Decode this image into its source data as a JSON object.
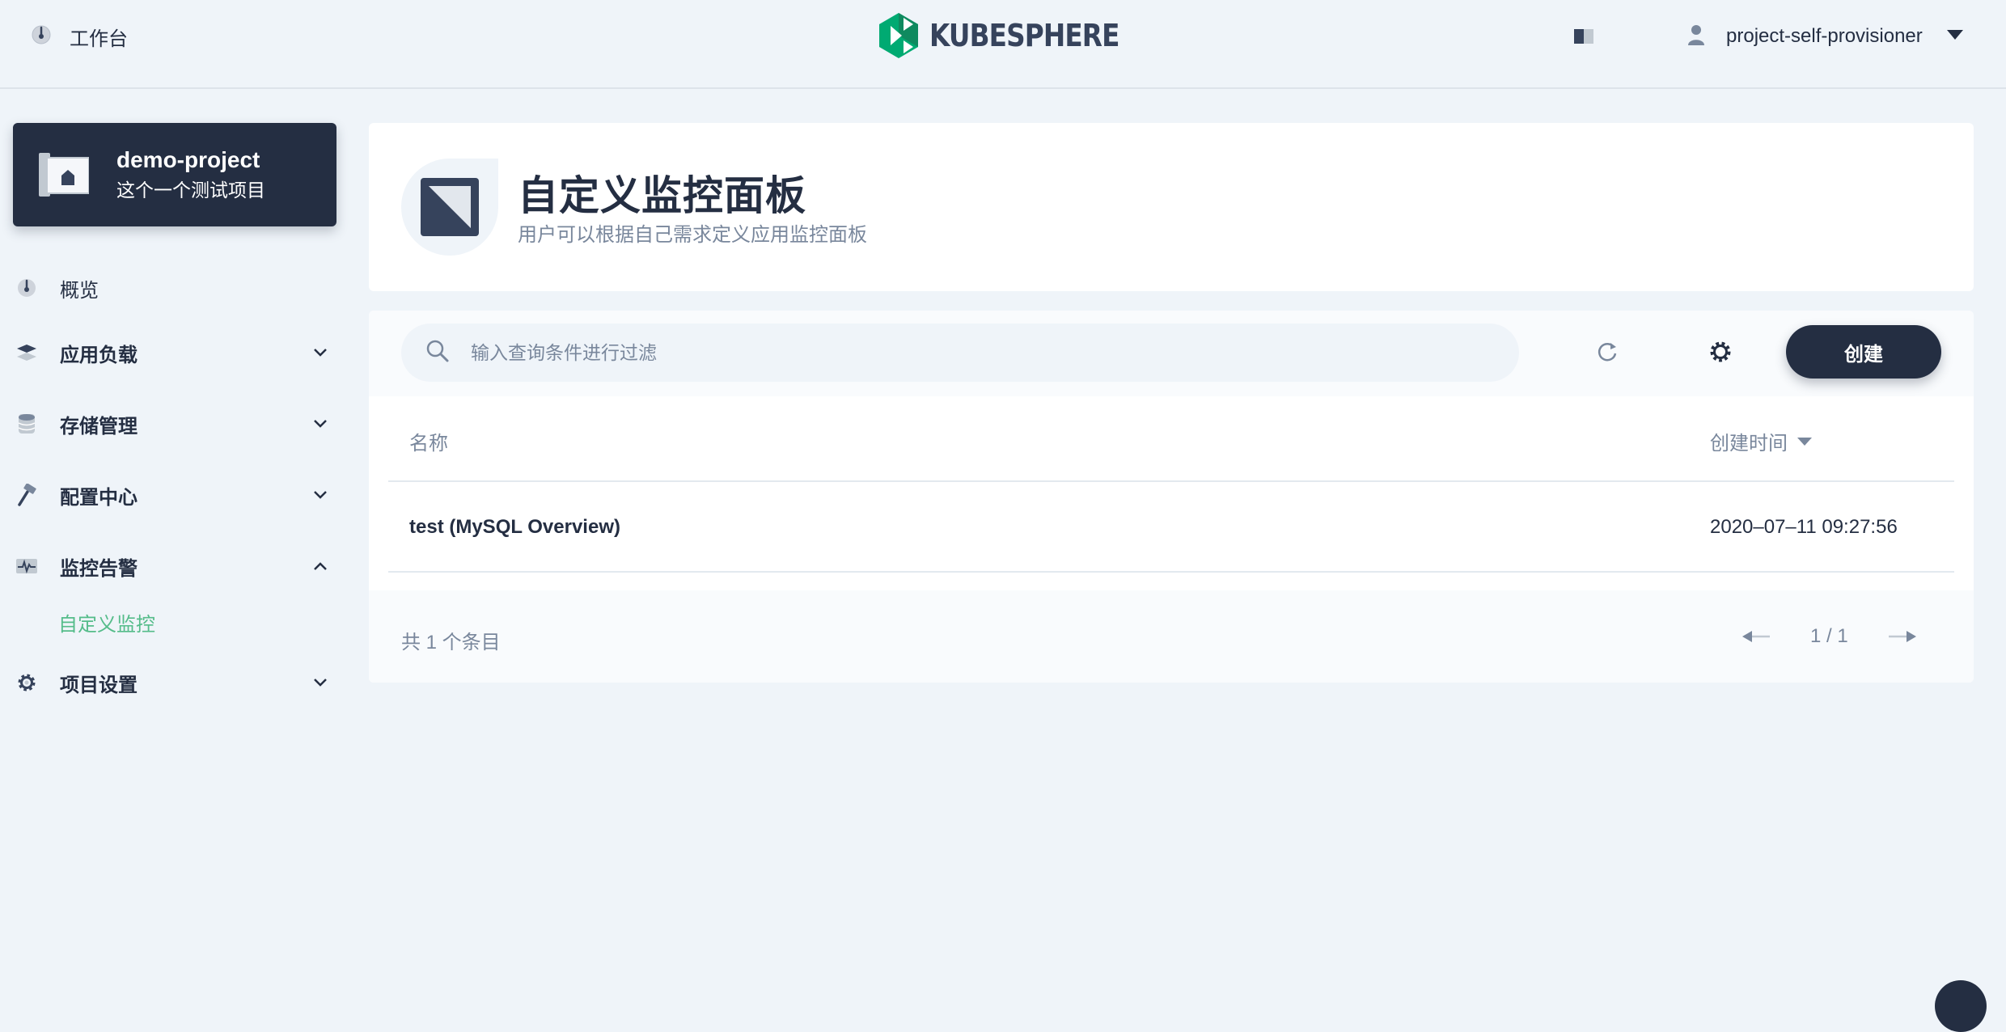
{
  "topbar": {
    "workbench_label": "工作台",
    "logo_text": "KUBESPHERE",
    "user_name": "project-self-provisioner"
  },
  "project": {
    "name": "demo-project",
    "description": "这个一个测试项目"
  },
  "sidebar": {
    "items": [
      {
        "label": "概览",
        "icon": "dashboard-icon"
      },
      {
        "label": "应用负载",
        "icon": "appcenter-icon",
        "expanded": false
      },
      {
        "label": "存储管理",
        "icon": "storage-icon",
        "expanded": false
      },
      {
        "label": "配置中心",
        "icon": "hammer-icon",
        "expanded": false
      },
      {
        "label": "监控告警",
        "icon": "monitor-icon",
        "expanded": true
      },
      {
        "label": "项目设置",
        "icon": "gear-icon",
        "expanded": false
      }
    ],
    "active_sub_item": "自定义监控"
  },
  "banner": {
    "title": "自定义监控面板",
    "subtitle": "用户可以根据自己需求定义应用监控面板"
  },
  "toolbar": {
    "search_placeholder": "输入查询条件进行过滤",
    "create_label": "创建"
  },
  "table": {
    "columns": [
      "名称",
      "创建时间"
    ],
    "rows": [
      {
        "name": "test (MySQL Overview)",
        "created": "2020–07–11 09:27:56"
      }
    ]
  },
  "footer": {
    "total_text": "共 1 个条目",
    "page_text": "1 / 1"
  },
  "colors": {
    "primary_dark": "#242e42",
    "accent_green": "#55bc8a",
    "muted_text": "#79879c",
    "background": "#eff4f9"
  }
}
